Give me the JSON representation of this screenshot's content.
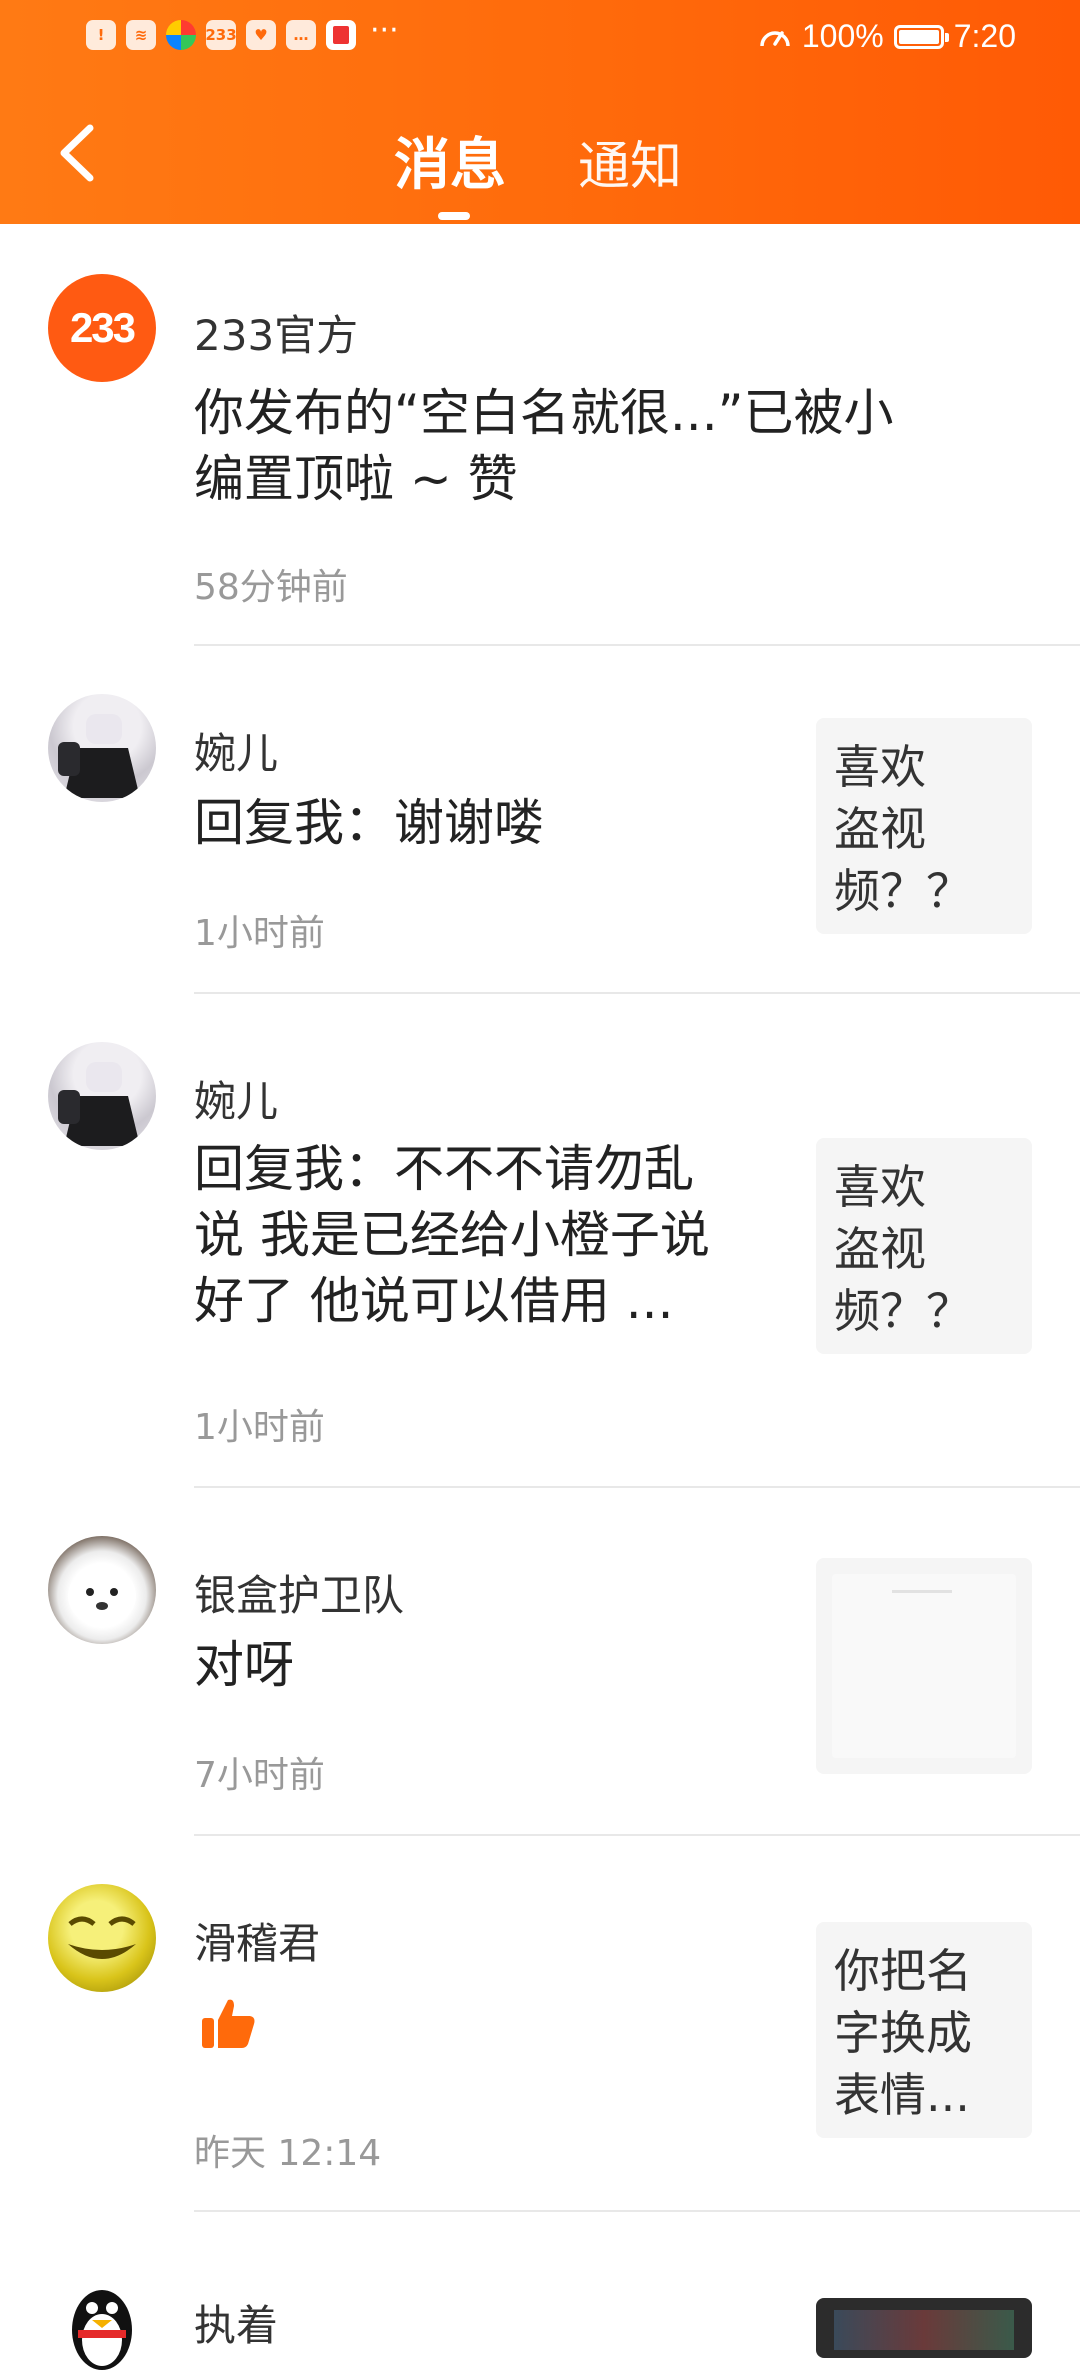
{
  "status_bar": {
    "app_icon_233": "233",
    "battery": "100%",
    "time": "7:20",
    "more": "···"
  },
  "header": {
    "tabs": [
      {
        "label": "消息",
        "active": true
      },
      {
        "label": "通知",
        "active": false
      }
    ],
    "accent_color": "#ff6a0b"
  },
  "messages": [
    {
      "avatar_text": "233",
      "name": "233官方",
      "content_lines": [
        "你发布的“空白名就很...”已被小",
        "编置顶啦 ~ 赞"
      ],
      "time": "58分钟前"
    },
    {
      "name": "婉儿",
      "content_lines": [
        "回复我：谢谢喽"
      ],
      "time": "1小时前",
      "thumb_lines": [
        "喜欢",
        "盗视",
        "频？？"
      ]
    },
    {
      "name": "婉儿",
      "content_lines": [
        "回复我：不不不请勿乱",
        "说 我是已经给小橙子说",
        "好了 他说可以借用 ..."
      ],
      "time": "1小时前",
      "thumb_lines": [
        "喜欢",
        "盗视",
        "频？？"
      ]
    },
    {
      "name": "银盒护卫队",
      "content_lines": [
        "对呀"
      ],
      "time": "7小时前",
      "thumb_lines": []
    },
    {
      "name": "滑稽君",
      "content_icon": "thumbs-up-icon",
      "time": "昨天 12:14",
      "thumb_lines": [
        "你把名",
        "字换成",
        "表情..."
      ]
    },
    {
      "name": "执着"
    }
  ]
}
